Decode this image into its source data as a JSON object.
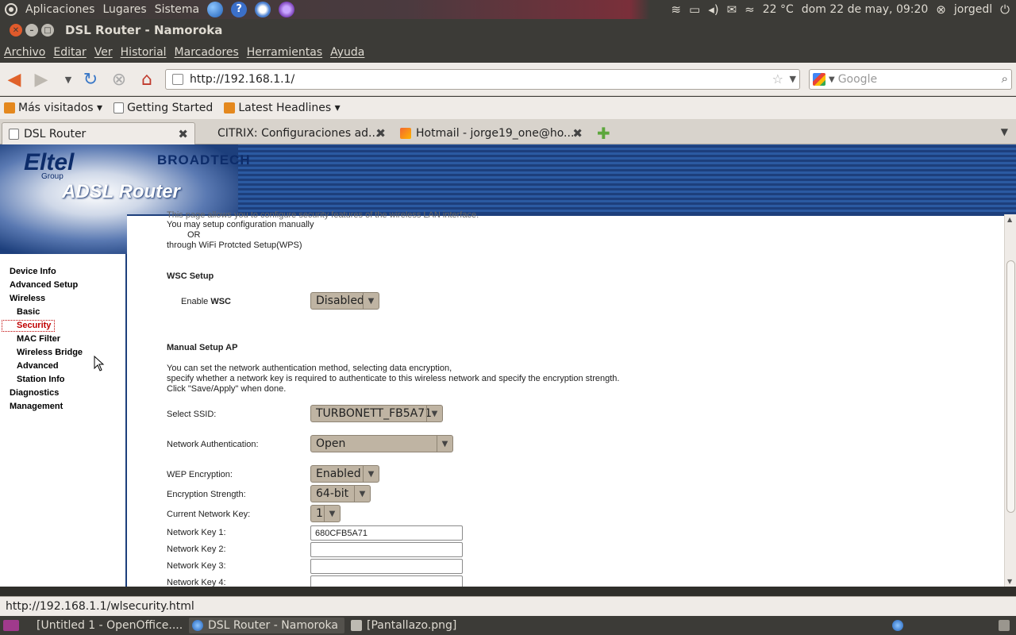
{
  "system_panel": {
    "menus": [
      "Aplicaciones",
      "Lugares",
      "Sistema"
    ],
    "temperature": "22 °C",
    "datetime": "dom 22 de may, 09:20",
    "user": "jorgedl"
  },
  "window": {
    "title": "DSL Router - Namoroka"
  },
  "menubar": [
    "Archivo",
    "Editar",
    "Ver",
    "Historial",
    "Marcadores",
    "Herramientas",
    "Ayuda"
  ],
  "navbar": {
    "url": "http://192.168.1.1/",
    "search_placeholder": "Google"
  },
  "bookmarks": [
    "Más visitados ▾",
    "Getting Started",
    "Latest Headlines ▾"
  ],
  "tabs": [
    {
      "label": "DSL Router"
    },
    {
      "label": "CITRIX: Configuraciones ad..."
    },
    {
      "label": "Hotmail - jorge19_one@ho..."
    }
  ],
  "banner": {
    "brand": "Eltel",
    "group": "Group",
    "product": "ADSL Router",
    "partner": "BROADTECH"
  },
  "sidebar": {
    "items": [
      {
        "label": "Device Info"
      },
      {
        "label": "Advanced Setup"
      },
      {
        "label": "Wireless"
      },
      {
        "label": "Basic"
      },
      {
        "label": "Security"
      },
      {
        "label": "MAC Filter"
      },
      {
        "label": "Wireless Bridge"
      },
      {
        "label": "Advanced"
      },
      {
        "label": "Station Info"
      },
      {
        "label": "Diagnostics"
      },
      {
        "label": "Management"
      }
    ]
  },
  "content": {
    "intro_cut": "This page allows you to configure security features of the wireless LAN interface.",
    "intro_1": "You may setup configuration manually",
    "intro_or": "OR",
    "intro_2": "through WiFi Protcted Setup(WPS)",
    "wsc_heading": "WSC Setup",
    "wsc_label_prefix": "Enable ",
    "wsc_label_bold": "WSC",
    "wsc_value": "Disabled",
    "manual_heading": "Manual Setup AP",
    "manual_desc_1": "You can set the network authentication method, selecting data encryption,",
    "manual_desc_2": "specify whether a network key is required to authenticate to this wireless network and specify the encryption strength.",
    "manual_desc_3": "Click \"Save/Apply\" when done.",
    "ssid_label": "Select SSID:",
    "ssid_value": "TURBONETT_FB5A71",
    "auth_label": "Network Authentication:",
    "auth_value": "Open",
    "wep_label": "WEP Encryption:",
    "wep_value": "Enabled",
    "strength_label": "Encryption Strength:",
    "strength_value": "64-bit",
    "current_key_label": "Current Network Key:",
    "current_key_value": "1",
    "key1_label": "Network Key 1:",
    "key1_value": "680CFB5A71",
    "key2_label": "Network Key 2:",
    "key2_value": "",
    "key3_label": "Network Key 3:",
    "key3_value": "",
    "key4_label": "Network Key 4:",
    "key4_value": ""
  },
  "statusbar": {
    "text": "http://192.168.1.1/wlsecurity.html"
  },
  "taskbar": [
    {
      "label": "[Untitled 1 - OpenOffice...."
    },
    {
      "label": "DSL Router - Namoroka"
    },
    {
      "label": "[Pantallazo.png]"
    }
  ],
  "colors": {
    "router_blue": "#1d3f7c",
    "select_bg": "#bfb4a3",
    "active_nav": "#c00000",
    "ubuntu_panel": "#3c3b37"
  }
}
